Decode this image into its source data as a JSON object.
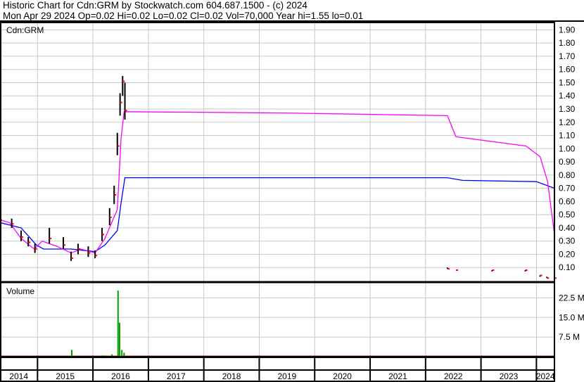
{
  "header": {
    "line1": "Historic Chart for Cdn:GRM by Stockwatch.com 604.687.1500 - (c) 2024",
    "line2": "Mon Apr 29 2024   Op=0.02   Hi=0.02   Lo=0.02   Cl=0.02   Vol=70,000   Year hi=1.55   lo=0.01"
  },
  "chart_data": [
    {
      "type": "line",
      "title": "Cdn:GRM",
      "ylim": [
        0,
        1.95
      ],
      "yticks": [
        "1.90",
        "1.80",
        "1.70",
        "1.60",
        "1.50",
        "1.40",
        "1.30",
        "1.20",
        "1.10",
        "1.00",
        "0.90",
        "0.80",
        "0.70",
        "0.60",
        "0.50",
        "0.40",
        "0.30",
        "0.20",
        "0.10"
      ],
      "xlabels": [
        "2014",
        "2015",
        "2016",
        "2017",
        "2018",
        "2019",
        "2020",
        "2021",
        "2022",
        "2023",
        "2024"
      ],
      "xrange": [
        "2014-04-29",
        "2024-04-29"
      ],
      "grid": true,
      "colors": {
        "price": "#000000",
        "close": "#ff0000",
        "ma_short": "#ff00ff",
        "ma_long": "#0000ff"
      },
      "price": [
        {
          "date": "2014-04-29",
          "high": 0.49,
          "low": 0.42,
          "close": 0.46
        },
        {
          "date": "2014-07-15",
          "high": 0.47,
          "low": 0.4,
          "close": 0.43
        },
        {
          "date": "2014-09-15",
          "high": 0.38,
          "low": 0.3,
          "close": 0.33
        },
        {
          "date": "2014-11-01",
          "high": 0.33,
          "low": 0.26,
          "close": 0.29
        },
        {
          "date": "2014-12-15",
          "high": 0.28,
          "low": 0.21,
          "close": 0.24
        },
        {
          "date": "2015-03-20",
          "high": 0.4,
          "low": 0.28,
          "close": 0.32
        },
        {
          "date": "2015-06-20",
          "high": 0.33,
          "low": 0.24,
          "close": 0.27
        },
        {
          "date": "2015-08-10",
          "high": 0.22,
          "low": 0.15,
          "close": 0.17
        },
        {
          "date": "2015-09-25",
          "high": 0.28,
          "low": 0.2,
          "close": 0.24
        },
        {
          "date": "2015-12-01",
          "high": 0.26,
          "low": 0.18,
          "close": 0.21
        },
        {
          "date": "2016-01-15",
          "high": 0.23,
          "low": 0.17,
          "close": 0.19
        },
        {
          "date": "2016-03-01",
          "high": 0.4,
          "low": 0.3,
          "close": 0.35
        },
        {
          "date": "2016-04-20",
          "high": 0.55,
          "low": 0.42,
          "close": 0.48
        },
        {
          "date": "2016-05-20",
          "high": 0.72,
          "low": 0.58,
          "close": 0.65
        },
        {
          "date": "2016-06-10",
          "high": 1.12,
          "low": 0.95,
          "close": 1.02
        },
        {
          "date": "2016-06-28",
          "high": 1.42,
          "low": 1.25,
          "close": 1.35
        },
        {
          "date": "2016-07-15",
          "high": 1.55,
          "low": 1.4,
          "close": 1.51
        },
        {
          "date": "2016-07-30",
          "high": 1.5,
          "low": 1.22,
          "close": 1.29
        },
        {
          "date": "2022-05-25",
          "high": 0.1,
          "low": 0.09,
          "close": 0.09
        },
        {
          "date": "2022-07-20",
          "high": 0.08,
          "low": 0.08,
          "close": 0.08
        },
        {
          "date": "2023-03-15",
          "high": 0.08,
          "low": 0.07,
          "close": 0.08
        },
        {
          "date": "2023-10-20",
          "high": 0.08,
          "low": 0.07,
          "close": 0.08
        },
        {
          "date": "2024-01-25",
          "high": 0.04,
          "low": 0.03,
          "close": 0.04
        },
        {
          "date": "2024-03-10",
          "high": 0.03,
          "low": 0.02,
          "close": 0.02
        },
        {
          "date": "2024-04-29",
          "high": 0.02,
          "low": 0.02,
          "close": 0.02
        }
      ],
      "ma_short": [
        [
          "2014-04-29",
          0.46
        ],
        [
          "2014-07-01",
          0.44
        ],
        [
          "2014-09-15",
          0.32
        ],
        [
          "2014-12-10",
          0.24
        ],
        [
          "2015-02-01",
          0.3
        ],
        [
          "2015-05-10",
          0.26
        ],
        [
          "2015-08-10",
          0.21
        ],
        [
          "2015-10-15",
          0.24
        ],
        [
          "2016-01-15",
          0.21
        ],
        [
          "2016-03-20",
          0.32
        ],
        [
          "2016-06-10",
          0.54
        ],
        [
          "2016-07-05",
          1.08
        ],
        [
          "2016-07-25",
          1.28
        ],
        [
          "2019-06-20",
          1.27
        ],
        [
          "2022-05-25",
          1.25
        ],
        [
          "2022-07-20",
          1.09
        ],
        [
          "2023-10-25",
          1.02
        ],
        [
          "2024-01-25",
          0.94
        ],
        [
          "2024-03-15",
          0.75
        ],
        [
          "2024-04-29",
          0.35
        ]
      ],
      "ma_long": [
        [
          "2014-04-29",
          0.44
        ],
        [
          "2014-09-15",
          0.4
        ],
        [
          "2014-12-25",
          0.27
        ],
        [
          "2015-02-10",
          0.24
        ],
        [
          "2015-08-10",
          0.24
        ],
        [
          "2016-01-15",
          0.22
        ],
        [
          "2016-03-20",
          0.27
        ],
        [
          "2016-06-10",
          0.38
        ],
        [
          "2016-07-05",
          0.59
        ],
        [
          "2016-07-30",
          0.78
        ],
        [
          "2019-06-20",
          0.78
        ],
        [
          "2022-05-25",
          0.78
        ],
        [
          "2022-09-01",
          0.76
        ],
        [
          "2024-01-01",
          0.75
        ],
        [
          "2024-04-29",
          0.7
        ]
      ]
    },
    {
      "type": "bar",
      "title": "Volume",
      "ylim": [
        0,
        28000000
      ],
      "yticks": [
        "22.5 M",
        "15.0 M",
        "7.5 M"
      ],
      "color": "#00a000",
      "values": [
        [
          "2014-06-01",
          300000
        ],
        [
          "2014-11-01",
          400000
        ],
        [
          "2015-02-15",
          300000
        ],
        [
          "2015-08-10",
          2600000
        ],
        [
          "2015-11-01",
          300000
        ],
        [
          "2016-03-01",
          500000
        ],
        [
          "2016-05-01",
          900000
        ],
        [
          "2016-06-10",
          25300000
        ],
        [
          "2016-06-20",
          13000000
        ],
        [
          "2016-07-05",
          2600000
        ],
        [
          "2016-07-20",
          1500000
        ],
        [
          "2022-06-01",
          150000
        ],
        [
          "2023-09-01",
          200000
        ],
        [
          "2024-02-01",
          400000
        ],
        [
          "2024-04-10",
          300000
        ]
      ]
    }
  ]
}
